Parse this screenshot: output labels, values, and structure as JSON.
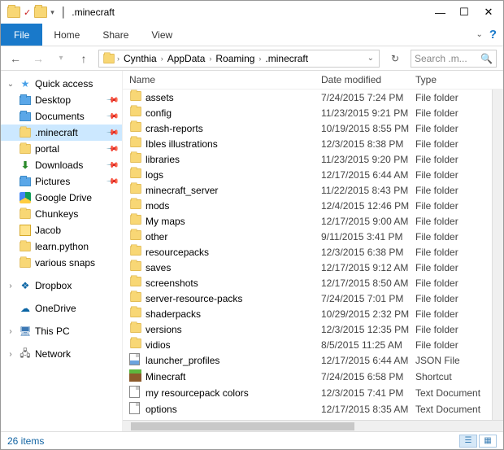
{
  "window": {
    "title": ".minecraft"
  },
  "menu": {
    "file": "File",
    "home": "Home",
    "share": "Share",
    "view": "View"
  },
  "breadcrumbs": [
    "Cynthia",
    "AppData",
    "Roaming",
    ".minecraft"
  ],
  "search": {
    "placeholder": "Search .m..."
  },
  "sidebar": {
    "quick_access": "Quick access",
    "items": [
      {
        "label": "Desktop",
        "icon": "desktop",
        "pinned": true
      },
      {
        "label": "Documents",
        "icon": "documents",
        "pinned": true
      },
      {
        "label": ".minecraft",
        "icon": "folder",
        "pinned": true,
        "selected": true
      },
      {
        "label": "portal",
        "icon": "folder",
        "pinned": true
      },
      {
        "label": "Downloads",
        "icon": "downloads",
        "pinned": true
      },
      {
        "label": "Pictures",
        "icon": "pictures",
        "pinned": true
      },
      {
        "label": "Google Drive",
        "icon": "gdrive",
        "pinned": false
      },
      {
        "label": "Chunkeys",
        "icon": "folder",
        "pinned": false
      },
      {
        "label": "Jacob",
        "icon": "jacob",
        "pinned": false
      },
      {
        "label": "learn.python",
        "icon": "folder",
        "pinned": false
      },
      {
        "label": "various snaps",
        "icon": "folder",
        "pinned": false
      }
    ],
    "dropbox": "Dropbox",
    "onedrive": "OneDrive",
    "this_pc": "This PC",
    "network": "Network"
  },
  "columns": {
    "name": "Name",
    "date": "Date modified",
    "type": "Type"
  },
  "files": [
    {
      "name": "assets",
      "date": "7/24/2015 7:24 PM",
      "type": "File folder",
      "icon": "folder"
    },
    {
      "name": "config",
      "date": "11/23/2015 9:21 PM",
      "type": "File folder",
      "icon": "folder"
    },
    {
      "name": "crash-reports",
      "date": "10/19/2015 8:55 PM",
      "type": "File folder",
      "icon": "folder"
    },
    {
      "name": "Ibles illustrations",
      "date": "12/3/2015 8:38 PM",
      "type": "File folder",
      "icon": "folder"
    },
    {
      "name": "libraries",
      "date": "11/23/2015 9:20 PM",
      "type": "File folder",
      "icon": "folder"
    },
    {
      "name": "logs",
      "date": "12/17/2015 6:44 AM",
      "type": "File folder",
      "icon": "folder"
    },
    {
      "name": "minecraft_server",
      "date": "11/22/2015 8:43 PM",
      "type": "File folder",
      "icon": "folder"
    },
    {
      "name": "mods",
      "date": "12/4/2015 12:46 PM",
      "type": "File folder",
      "icon": "folder"
    },
    {
      "name": "My maps",
      "date": "12/17/2015 9:00 AM",
      "type": "File folder",
      "icon": "folder"
    },
    {
      "name": "other",
      "date": "9/11/2015 3:41 PM",
      "type": "File folder",
      "icon": "folder"
    },
    {
      "name": "resourcepacks",
      "date": "12/3/2015 6:38 PM",
      "type": "File folder",
      "icon": "folder"
    },
    {
      "name": "saves",
      "date": "12/17/2015 9:12 AM",
      "type": "File folder",
      "icon": "folder"
    },
    {
      "name": "screenshots",
      "date": "12/17/2015 8:50 AM",
      "type": "File folder",
      "icon": "folder"
    },
    {
      "name": "server-resource-packs",
      "date": "7/24/2015 7:01 PM",
      "type": "File folder",
      "icon": "folder"
    },
    {
      "name": "shaderpacks",
      "date": "10/29/2015 2:32 PM",
      "type": "File folder",
      "icon": "folder"
    },
    {
      "name": "versions",
      "date": "12/3/2015 12:35 PM",
      "type": "File folder",
      "icon": "folder"
    },
    {
      "name": "vidios",
      "date": "8/5/2015 11:25 AM",
      "type": "File folder",
      "icon": "folder"
    },
    {
      "name": "launcher_profiles",
      "date": "12/17/2015 6:44 AM",
      "type": "JSON File",
      "icon": "json"
    },
    {
      "name": "Minecraft",
      "date": "7/24/2015 6:58 PM",
      "type": "Shortcut",
      "icon": "grass"
    },
    {
      "name": "my resourcepack colors",
      "date": "12/3/2015 7:41 PM",
      "type": "Text Document",
      "icon": "doc"
    },
    {
      "name": "options",
      "date": "12/17/2015 8:35 AM",
      "type": "Text Document",
      "icon": "doc"
    }
  ],
  "status": {
    "count": "26 items"
  }
}
